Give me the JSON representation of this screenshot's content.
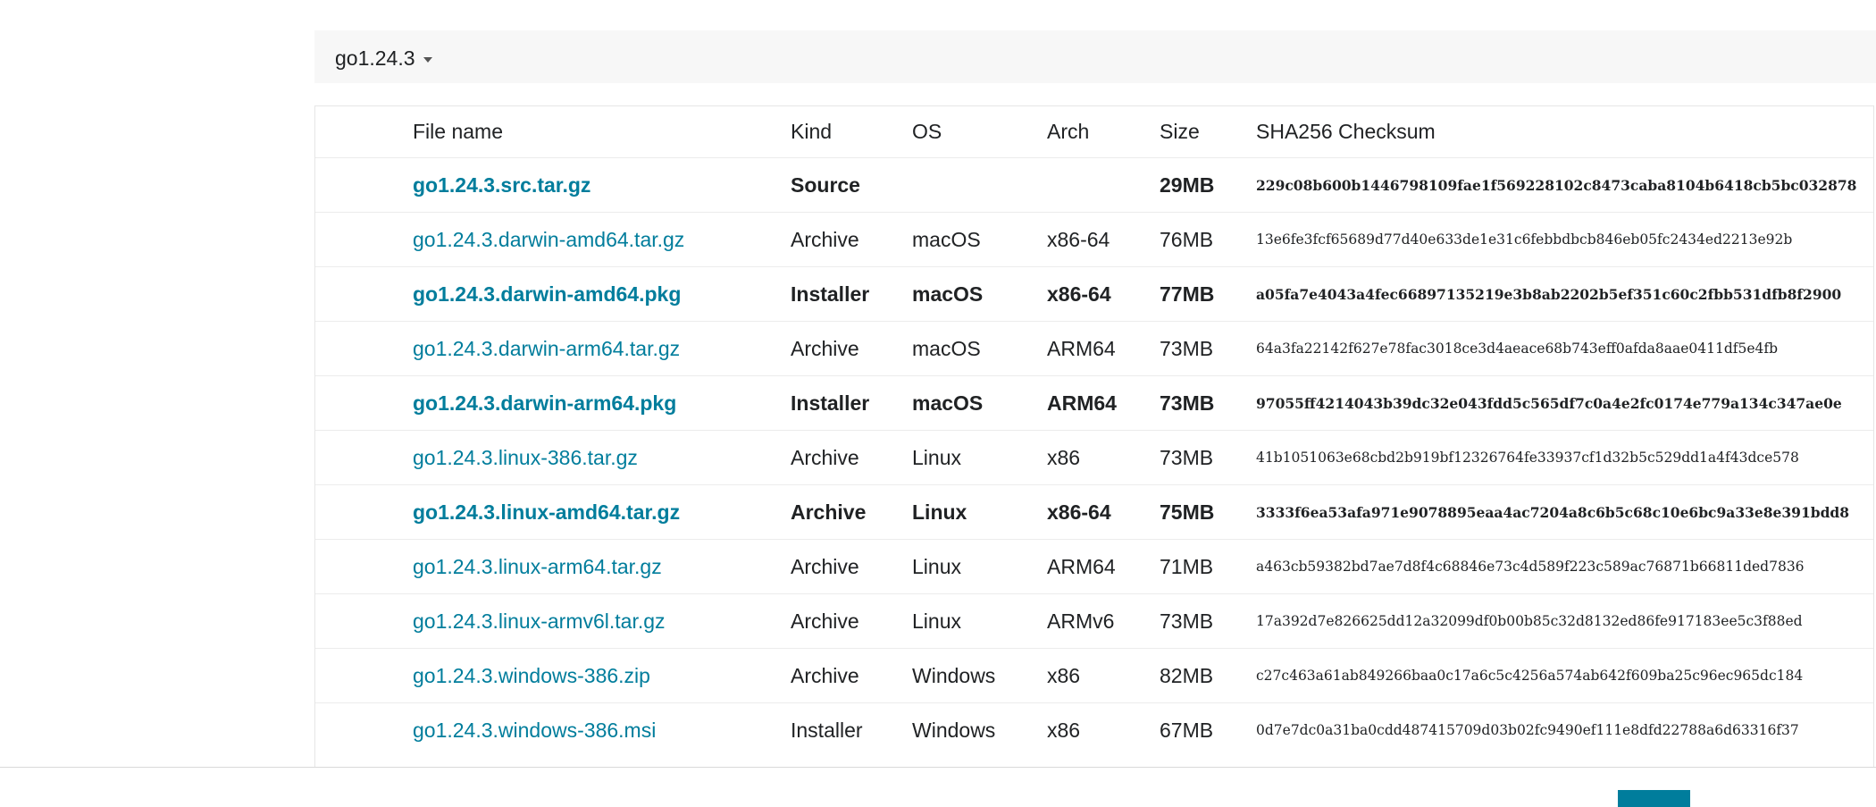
{
  "version_toggle": {
    "label": "go1.24.3"
  },
  "table": {
    "headers": [
      "File name",
      "Kind",
      "OS",
      "Arch",
      "Size",
      "SHA256 Checksum"
    ],
    "rows": [
      {
        "file": "go1.24.3.src.tar.gz",
        "kind": "Source",
        "os": "",
        "arch": "",
        "size": "29MB",
        "sha": "229c08b600b1446798109fae1f569228102c8473caba8104b6418cb5bc032878",
        "highlight": true
      },
      {
        "file": "go1.24.3.darwin-amd64.tar.gz",
        "kind": "Archive",
        "os": "macOS",
        "arch": "x86-64",
        "size": "76MB",
        "sha": "13e6fe3fcf65689d77d40e633de1e31c6febbdbcb846eb05fc2434ed2213e92b",
        "highlight": false
      },
      {
        "file": "go1.24.3.darwin-amd64.pkg",
        "kind": "Installer",
        "os": "macOS",
        "arch": "x86-64",
        "size": "77MB",
        "sha": "a05fa7e4043a4fec66897135219e3b8ab2202b5ef351c60c2fbb531dfb8f2900",
        "highlight": true
      },
      {
        "file": "go1.24.3.darwin-arm64.tar.gz",
        "kind": "Archive",
        "os": "macOS",
        "arch": "ARM64",
        "size": "73MB",
        "sha": "64a3fa22142f627e78fac3018ce3d4aeace68b743eff0afda8aae0411df5e4fb",
        "highlight": false
      },
      {
        "file": "go1.24.3.darwin-arm64.pkg",
        "kind": "Installer",
        "os": "macOS",
        "arch": "ARM64",
        "size": "73MB",
        "sha": "97055ff4214043b39dc32e043fdd5c565df7c0a4e2fc0174e779a134c347ae0e",
        "highlight": true
      },
      {
        "file": "go1.24.3.linux-386.tar.gz",
        "kind": "Archive",
        "os": "Linux",
        "arch": "x86",
        "size": "73MB",
        "sha": "41b1051063e68cbd2b919bf12326764fe33937cf1d32b5c529dd1a4f43dce578",
        "highlight": false
      },
      {
        "file": "go1.24.3.linux-amd64.tar.gz",
        "kind": "Archive",
        "os": "Linux",
        "arch": "x86-64",
        "size": "75MB",
        "sha": "3333f6ea53afa971e9078895eaa4ac7204a8c6b5c68c10e6bc9a33e8e391bdd8",
        "highlight": true
      },
      {
        "file": "go1.24.3.linux-arm64.tar.gz",
        "kind": "Archive",
        "os": "Linux",
        "arch": "ARM64",
        "size": "71MB",
        "sha": "a463cb59382bd7ae7d8f4c68846e73c4d589f223c589ac76871b66811ded7836",
        "highlight": false
      },
      {
        "file": "go1.24.3.linux-armv6l.tar.gz",
        "kind": "Archive",
        "os": "Linux",
        "arch": "ARMv6",
        "size": "73MB",
        "sha": "17a392d7e826625dd12a32099df0b00b85c32d8132ed86fe917183ee5c3f88ed",
        "highlight": false
      },
      {
        "file": "go1.24.3.windows-386.zip",
        "kind": "Archive",
        "os": "Windows",
        "arch": "x86",
        "size": "82MB",
        "sha": "c27c463a61ab849266baa0c17a6c5c4256a574ab642f609ba25c96ec965dc184",
        "highlight": false
      },
      {
        "file": "go1.24.3.windows-386.msi",
        "kind": "Installer",
        "os": "Windows",
        "arch": "x86",
        "size": "67MB",
        "sha": "0d7e7dc0a31ba0cdd487415709d03b02fc9490ef111e8dfd22788a6d63316f37",
        "highlight": false
      }
    ]
  },
  "colors": {
    "link": "#007d9c",
    "accent_bar": "#007d9c",
    "header_bg": "#f7f7f7"
  }
}
